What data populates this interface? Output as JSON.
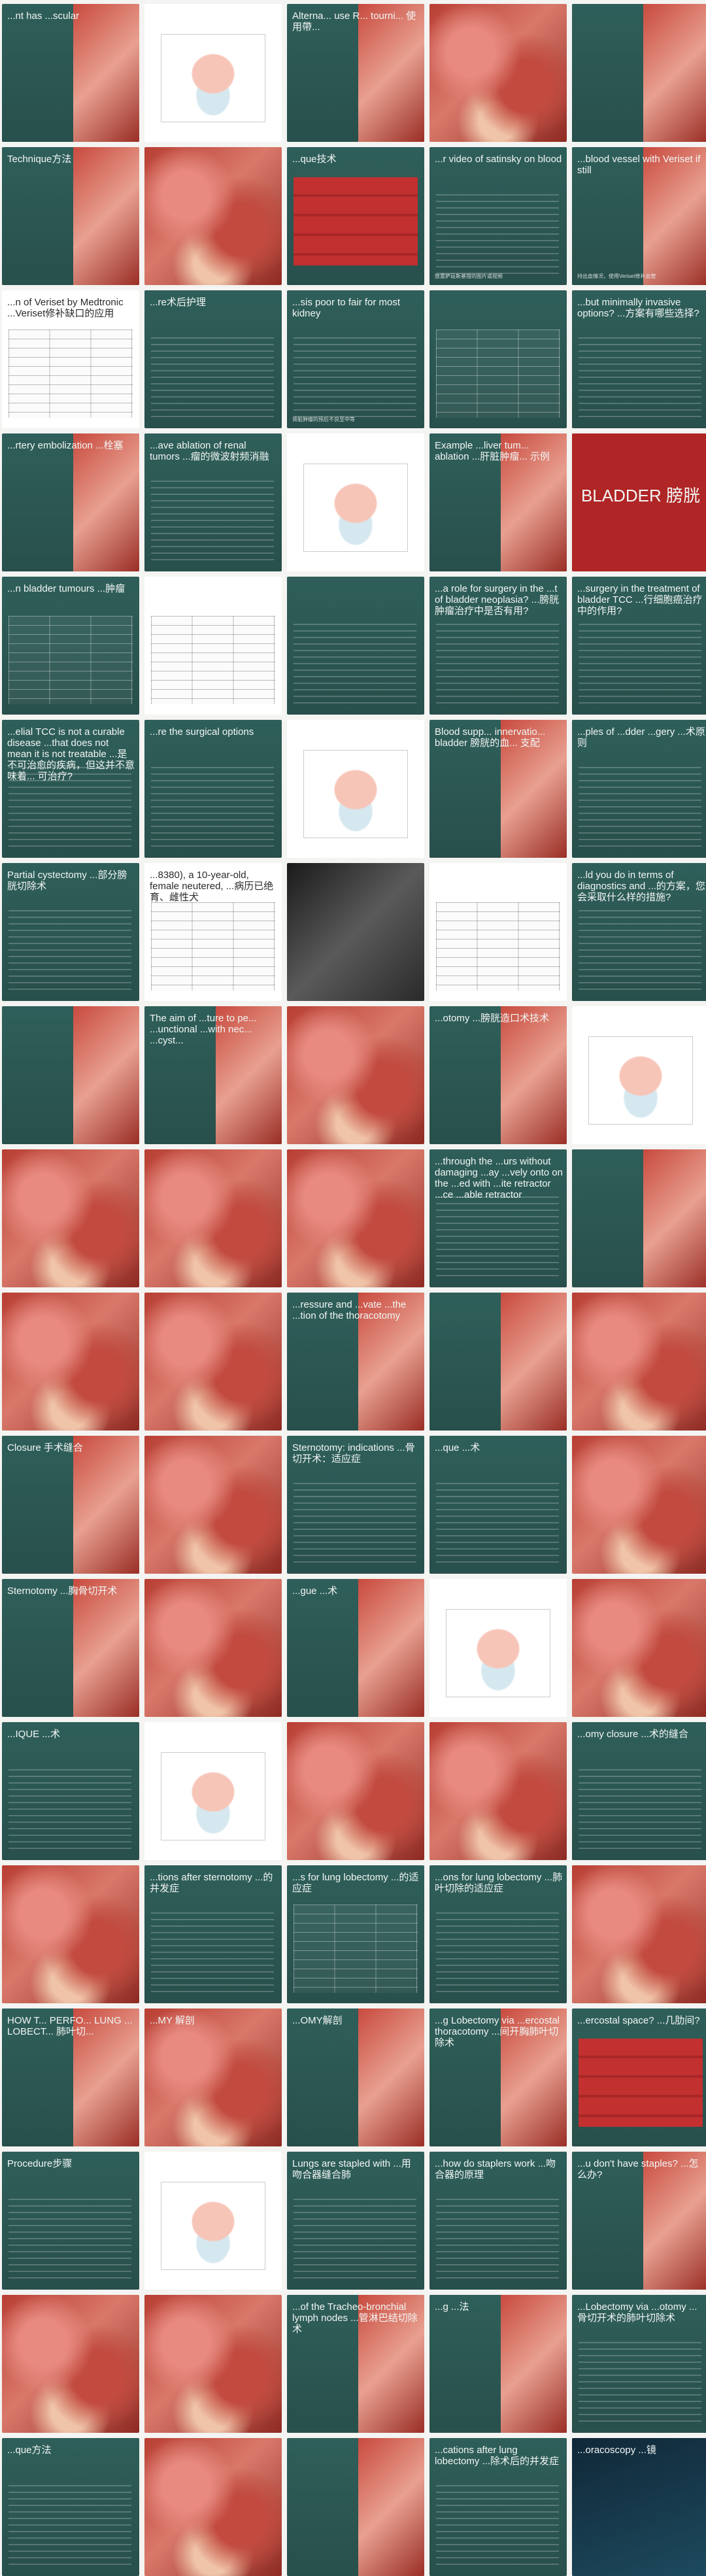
{
  "slides": [
    {
      "kind": "teal-img",
      "title": "...nt has ...scular",
      "sub": ""
    },
    {
      "kind": "white",
      "title": "",
      "sub": ""
    },
    {
      "kind": "teal-img",
      "title": "Alterna... use R... tourni... 使用帶...",
      "sub": ""
    },
    {
      "kind": "photo",
      "title": "",
      "sub": ""
    },
    {
      "kind": "teal-img",
      "title": "",
      "sub": ""
    },
    {
      "kind": "teal-img-right",
      "title": "Technique方法",
      "sub": ""
    },
    {
      "kind": "photo",
      "title": "",
      "sub": ""
    },
    {
      "kind": "teal-red",
      "title": "...que技术",
      "sub": ""
    },
    {
      "kind": "teal",
      "title": "...r video of satinsky on blood",
      "sub": "放置萨廷斯基钳的图片或视频"
    },
    {
      "kind": "teal-img",
      "title": "...blood vessel with Veriset if still",
      "sub": "持出血情况，使用Veriset修补血管"
    },
    {
      "kind": "white-doc",
      "title": "...n of Veriset by Medtronic ...Veriset修补缺口的应用",
      "sub": ""
    },
    {
      "kind": "teal",
      "title": "...re术后护理",
      "sub": ""
    },
    {
      "kind": "teal",
      "title": "...sis poor to fair for most kidney",
      "sub": "肾脏肿瘤的预后不良至中等"
    },
    {
      "kind": "teal-table",
      "title": "",
      "sub": ""
    },
    {
      "kind": "teal",
      "title": "...but minimally invasive options? ...方案有哪些选择?",
      "sub": ""
    },
    {
      "kind": "teal-img",
      "title": "...rtery embolization ...栓塞",
      "sub": ""
    },
    {
      "kind": "teal",
      "title": "...ave ablation of renal tumors ...瘤的微波射频消融",
      "sub": ""
    },
    {
      "kind": "white",
      "title": "",
      "sub": ""
    },
    {
      "kind": "teal-img",
      "title": "Example ...liver tum... ablation ...肝脏肿瘤... 示例",
      "sub": ""
    },
    {
      "kind": "red",
      "title": "BLADDER 膀胱",
      "sub": ""
    },
    {
      "kind": "teal-table",
      "title": "...n bladder tumours ...肿瘤",
      "sub": ""
    },
    {
      "kind": "white-doc",
      "title": "",
      "sub": ""
    },
    {
      "kind": "teal",
      "title": "",
      "sub": ""
    },
    {
      "kind": "teal",
      "title": "...a role for surgery in the ...t of bladder neoplasia? ...膀胱肿瘤治疗中是否有用?",
      "sub": ""
    },
    {
      "kind": "teal",
      "title": "...surgery in the treatment of bladder TCC ...行细胞癌治疗中的作用?",
      "sub": ""
    },
    {
      "kind": "teal",
      "title": "...elial TCC is not a curable disease ...that does not mean it is not treatable ...是不可治愈的疾病，但这并不意味着... 可治疗?",
      "sub": ""
    },
    {
      "kind": "teal",
      "title": "...re the surgical options",
      "sub": ""
    },
    {
      "kind": "white",
      "title": "",
      "sub": ""
    },
    {
      "kind": "teal-img",
      "title": "Blood supp... innervatio... bladder 膀胱的血... 支配",
      "sub": ""
    },
    {
      "kind": "teal",
      "title": "...ples of ...dder ...gery ...术原则",
      "sub": ""
    },
    {
      "kind": "teal",
      "title": "Partial cystectomy ...部分膀胱切除术",
      "sub": ""
    },
    {
      "kind": "white-doc",
      "title": "...8380), a 10-year-old, female neutered, ...病历已绝育、雌性犬",
      "sub": ""
    },
    {
      "kind": "xray",
      "title": "",
      "sub": ""
    },
    {
      "kind": "white-doc",
      "title": "",
      "sub": ""
    },
    {
      "kind": "teal",
      "title": "...ld you do in terms of diagnostics and ...的方案，您会采取什么样的措施?",
      "sub": ""
    },
    {
      "kind": "teal-img",
      "title": "",
      "sub": ""
    },
    {
      "kind": "teal-img",
      "title": "The aim of ...ture to pe... ...unctional ...with nec... ...cyst...",
      "sub": ""
    },
    {
      "kind": "photo",
      "title": "",
      "sub": ""
    },
    {
      "kind": "teal-img",
      "title": "...otomy ...膀胱造口术技术",
      "sub": ""
    },
    {
      "kind": "white",
      "title": "",
      "sub": ""
    },
    {
      "kind": "photo",
      "title": "",
      "sub": ""
    },
    {
      "kind": "photo",
      "title": "",
      "sub": ""
    },
    {
      "kind": "photo",
      "title": "",
      "sub": ""
    },
    {
      "kind": "teal",
      "title": "...through the ...urs without damaging ...ay ...vely onto on the ...ed with ...ite retractor ...ce ...able retractor",
      "sub": ""
    },
    {
      "kind": "teal-img",
      "title": "",
      "sub": ""
    },
    {
      "kind": "photo",
      "title": "",
      "sub": ""
    },
    {
      "kind": "photo",
      "title": "",
      "sub": ""
    },
    {
      "kind": "teal-img-right",
      "title": "...ressure and ...vate ...the ...tion of the thoracotomy",
      "sub": ""
    },
    {
      "kind": "teal-img",
      "title": "",
      "sub": ""
    },
    {
      "kind": "photo",
      "title": "",
      "sub": ""
    },
    {
      "kind": "teal-img",
      "title": "Closure 手术缝合",
      "sub": ""
    },
    {
      "kind": "photo",
      "title": "",
      "sub": ""
    },
    {
      "kind": "teal",
      "title": "Sternotomy: indications ...骨切开术：适应症",
      "sub": ""
    },
    {
      "kind": "teal",
      "title": "...que ...术",
      "sub": ""
    },
    {
      "kind": "photo",
      "title": "",
      "sub": ""
    },
    {
      "kind": "teal-img",
      "title": "Sternotomy ...胸骨切开术",
      "sub": ""
    },
    {
      "kind": "photo",
      "title": "",
      "sub": ""
    },
    {
      "kind": "teal-img",
      "title": "...gue ...术",
      "sub": ""
    },
    {
      "kind": "white",
      "title": "",
      "sub": ""
    },
    {
      "kind": "photo",
      "title": "",
      "sub": ""
    },
    {
      "kind": "teal",
      "title": "...IQUE ...术",
      "sub": ""
    },
    {
      "kind": "white",
      "title": "",
      "sub": ""
    },
    {
      "kind": "photo",
      "title": "",
      "sub": ""
    },
    {
      "kind": "photo",
      "title": "",
      "sub": ""
    },
    {
      "kind": "teal",
      "title": "...omy closure ...术的缝合",
      "sub": ""
    },
    {
      "kind": "photo",
      "title": "",
      "sub": ""
    },
    {
      "kind": "teal",
      "title": "...tions after sternotomy ...的并发症",
      "sub": ""
    },
    {
      "kind": "teal-table",
      "title": "...s for lung lobectomy ...的适应症",
      "sub": ""
    },
    {
      "kind": "teal",
      "title": "...ons for lung lobectomy ...肺叶切除的适应症",
      "sub": ""
    },
    {
      "kind": "photo",
      "title": "",
      "sub": ""
    },
    {
      "kind": "teal-img",
      "title": "HOW T... PERFO... LUNG ... LOBECT... 肺叶切...",
      "sub": ""
    },
    {
      "kind": "photo",
      "title": "...MY 解剖",
      "sub": ""
    },
    {
      "kind": "teal-img",
      "title": "...OMY解剖",
      "sub": ""
    },
    {
      "kind": "teal-img",
      "title": "...g Lobectomy via ...ercostal thoracotomy ...间开胸肺叶切除术",
      "sub": ""
    },
    {
      "kind": "teal-red",
      "title": "...ercostal space? ...几肋间?",
      "sub": ""
    },
    {
      "kind": "teal",
      "title": "Procedure步骤",
      "sub": ""
    },
    {
      "kind": "white",
      "title": "",
      "sub": ""
    },
    {
      "kind": "teal",
      "title": "Lungs are stapled with ...用吻合器缝合肺",
      "sub": ""
    },
    {
      "kind": "teal",
      "title": "...how do staplers work ...吻合器的原理",
      "sub": ""
    },
    {
      "kind": "teal-img-right",
      "title": "...u don't have staples? ...怎么办?",
      "sub": ""
    },
    {
      "kind": "photo",
      "title": "",
      "sub": ""
    },
    {
      "kind": "photo",
      "title": "",
      "sub": ""
    },
    {
      "kind": "teal-img",
      "title": "...of the Tracheo-bronchial lymph nodes ...管淋巴结切除术",
      "sub": ""
    },
    {
      "kind": "teal-img",
      "title": "...g ...法",
      "sub": ""
    },
    {
      "kind": "teal",
      "title": "...Lobectomy via ...otomy ...骨切开术的肺叶切除术",
      "sub": ""
    },
    {
      "kind": "teal",
      "title": "...que方法",
      "sub": ""
    },
    {
      "kind": "photo",
      "title": "",
      "sub": ""
    },
    {
      "kind": "teal-img",
      "title": "",
      "sub": ""
    },
    {
      "kind": "teal",
      "title": "...cations after lung lobectomy ...除术后的并发症",
      "sub": ""
    },
    {
      "kind": "dark",
      "title": "...oracoscopy ...镜",
      "sub": ""
    }
  ]
}
